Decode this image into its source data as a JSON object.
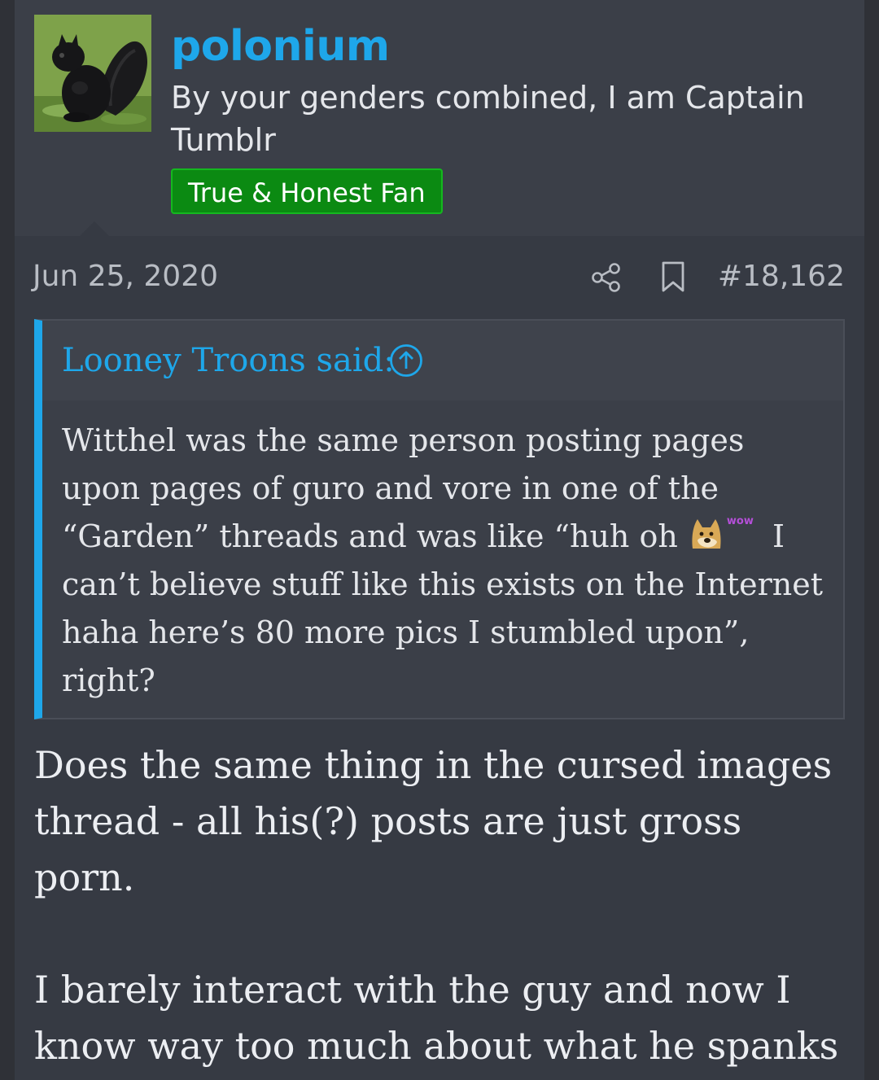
{
  "user": {
    "name": "polonium",
    "title": "By your genders combined, I am Captain Tumblr",
    "banner": "True & Honest Fan",
    "avatar_icon": "black-squirrel-avatar"
  },
  "post": {
    "date": "Jun 25, 2020",
    "number": "#18,162",
    "share_icon": "share-icon",
    "bookmark_icon": "bookmark-icon"
  },
  "quote": {
    "author": "Looney Troons said:",
    "text_part1": "Witthel was the same person posting pages upon pages of guro and vore in one of the “Garden” threads and was like “huh oh ",
    "emoji_label": "wow",
    "text_part2": " I can’t believe stuff like this exists on the Internet haha here’s 80 more pics I stumbled upon”, right?"
  },
  "reply": {
    "paragraph1": "Does the same thing in the cursed images thread - all his(?) posts are just gross porn.",
    "paragraph2": "I barely interact with the guy and now I know way too much about what he spanks it to"
  },
  "colors": {
    "background": "#2f3137",
    "post_bg": "#363a43",
    "accent": "#1ea7ea",
    "banner_green": "#0b8a12"
  }
}
